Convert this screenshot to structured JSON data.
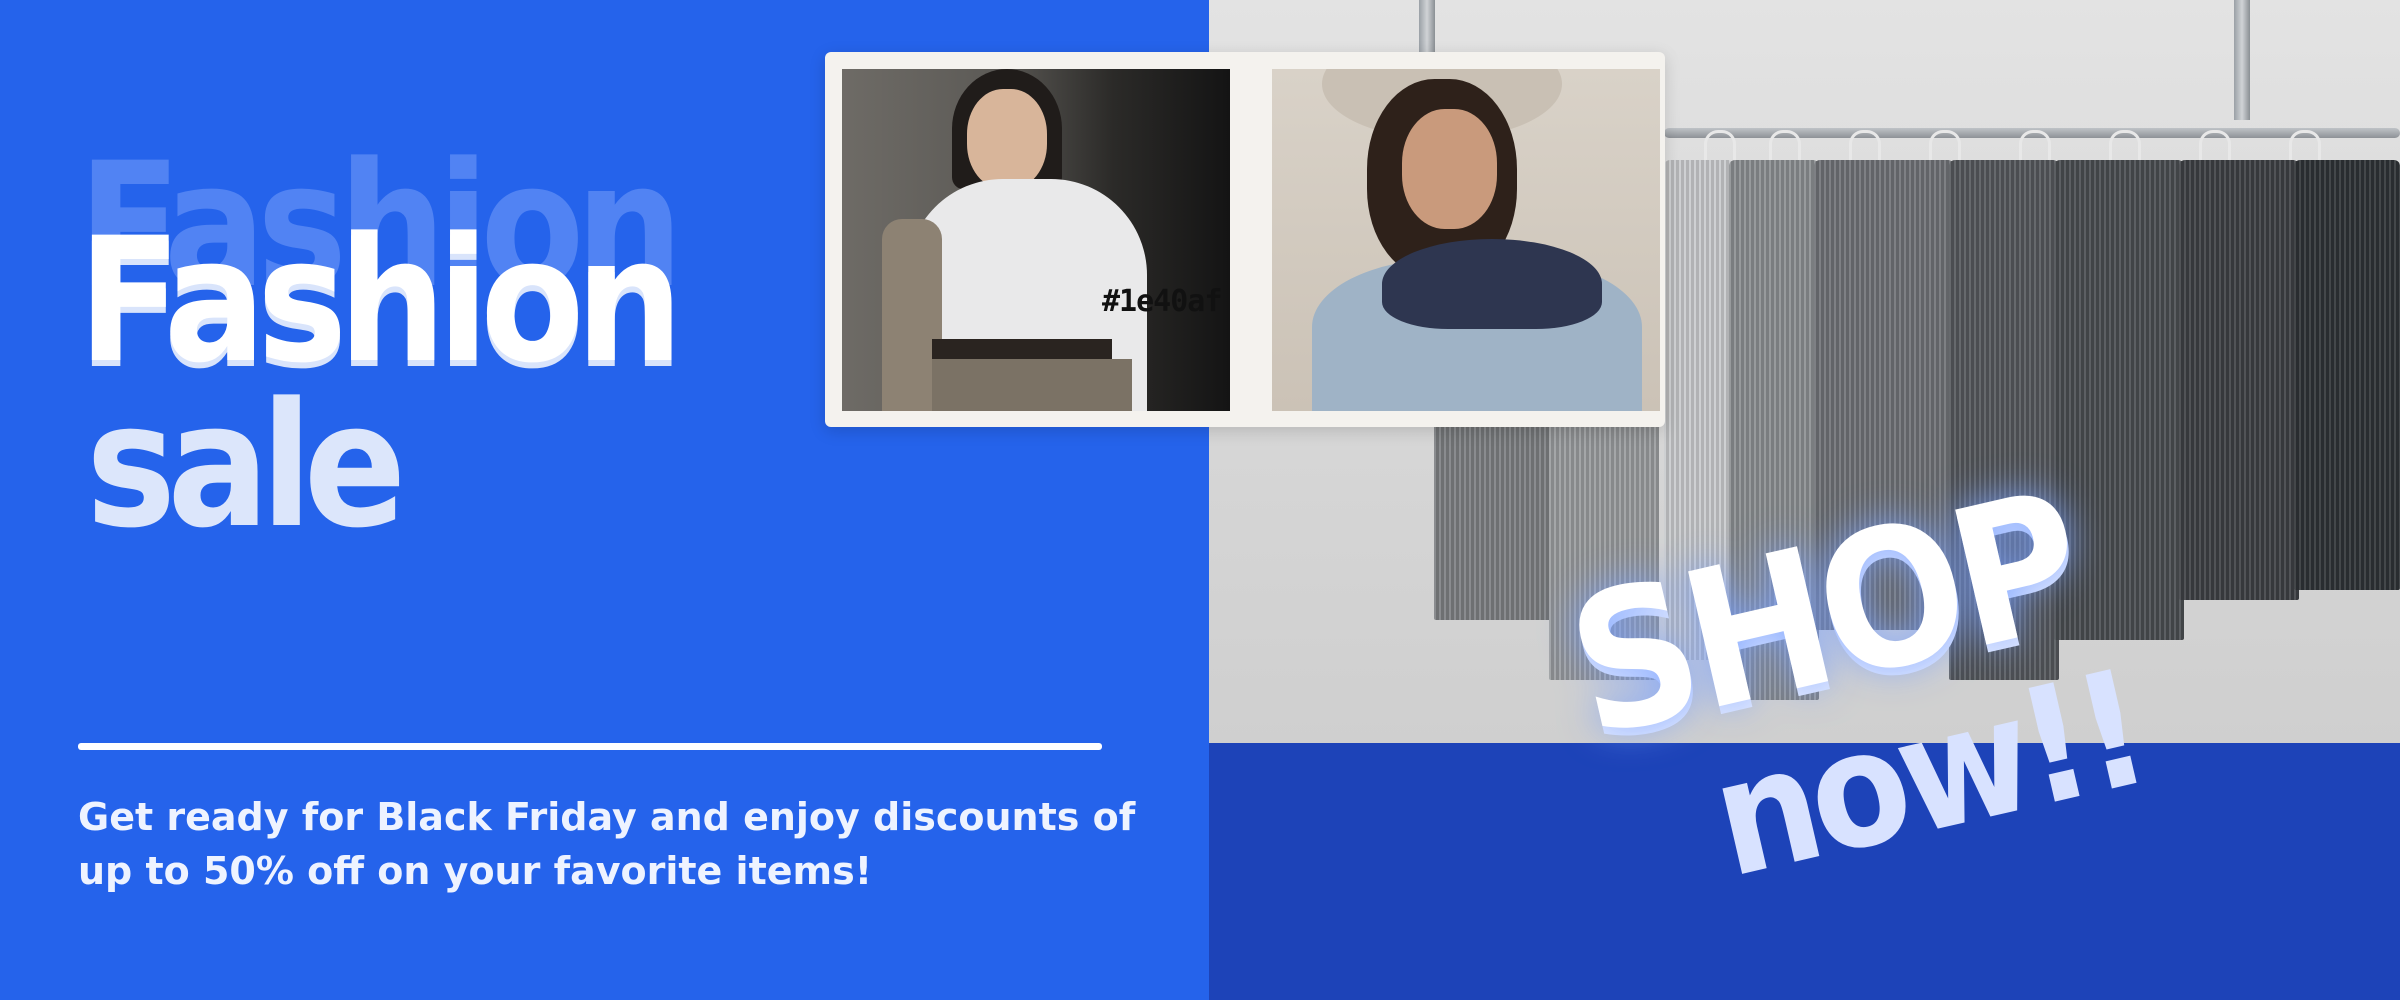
{
  "headline": {
    "ghost": "Fashion",
    "main": "Fashion",
    "sub": "sale"
  },
  "promo": {
    "text": "Get ready for Black Friday and enjoy discounts of up to 50% off on your favorite items!"
  },
  "photo_card": {
    "color_tag": "#1e40af"
  },
  "cta": {
    "shop": "SHOP",
    "now": "now!!"
  },
  "colors": {
    "background": "#2563eb",
    "bottom_right": "#1d43b8",
    "text": "#ffffff"
  }
}
